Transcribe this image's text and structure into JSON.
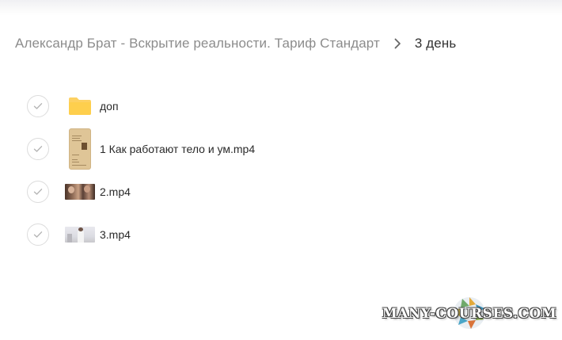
{
  "breadcrumb": {
    "parent": "Александр Брат - Вскрытие реальности. Тариф Стандарт",
    "separator_icon": "chevron-right-icon",
    "current": "3 день"
  },
  "files": [
    {
      "name": "доп",
      "type": "folder",
      "thumb": "folder-icon",
      "selected": false
    },
    {
      "name": "1 Как работают тело и ум.mp4",
      "type": "video",
      "thumb": "document-thumbnail",
      "selected": false
    },
    {
      "name": "2.mp4",
      "type": "video",
      "thumb": "video-thumbnail",
      "selected": false
    },
    {
      "name": "3.mp4",
      "type": "video",
      "thumb": "video-thumbnail",
      "selected": false
    }
  ],
  "watermark": {
    "text": "MANY-COURSES.COM"
  },
  "colors": {
    "folder": "#FDD162",
    "check_border": "#DCDCDC",
    "check_mark": "#B5B5B5",
    "breadcrumb_parent": "#8C8C8C",
    "breadcrumb_current": "#333333"
  }
}
